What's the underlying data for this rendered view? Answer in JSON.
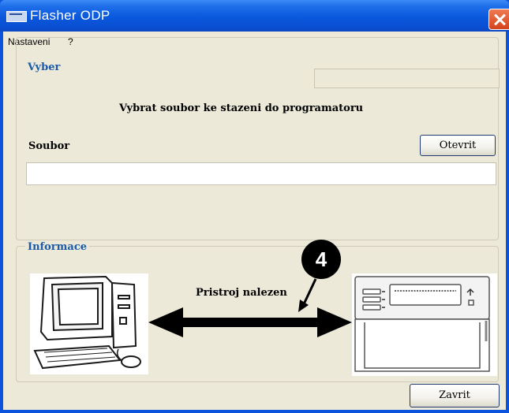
{
  "window": {
    "title": "Flasher ODP"
  },
  "menu": {
    "items": [
      "Nastaveni",
      "?"
    ]
  },
  "vyber": {
    "caption": "Vyber",
    "instruction": "Vybrat soubor ke stazeni do programatoru",
    "file_label": "Soubor",
    "open_button": "Otevrit",
    "file_value": ""
  },
  "informace": {
    "caption": "Informace",
    "status": "Pristroj nalezen",
    "callout_number": "4"
  },
  "footer": {
    "close_button": "Zavrit"
  },
  "icons": {
    "app": "app-icon",
    "close": "close-icon",
    "computer": "computer-icon",
    "device": "programmer-device-icon",
    "arrow": "double-arrow-icon"
  },
  "colors": {
    "titlebar": "#0a58dc",
    "client": "#ece9d8",
    "caption": "#1a5aa8",
    "close": "#d5431c"
  }
}
